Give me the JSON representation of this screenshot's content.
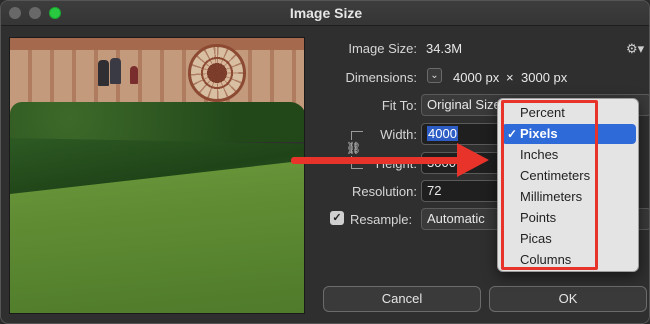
{
  "window": {
    "title": "Image Size"
  },
  "image_size": {
    "label": "Image Size:",
    "value": "34.3M"
  },
  "dimensions": {
    "label": "Dimensions:",
    "width": "4000 px",
    "times": "×",
    "height": "3000 px"
  },
  "fit_to": {
    "label": "Fit To:",
    "value": "Original Size"
  },
  "width": {
    "label": "Width:",
    "value": "4000"
  },
  "height": {
    "label": "Height:",
    "value": "3000"
  },
  "resolution": {
    "label": "Resolution:",
    "value": "72"
  },
  "resample": {
    "label": "Resample:",
    "value": "Automatic",
    "checked": true,
    "check_glyph": "✓"
  },
  "units_menu": {
    "items": [
      "Percent",
      "Pixels",
      "Inches",
      "Centimeters",
      "Millimeters",
      "Points",
      "Picas",
      "Columns"
    ],
    "selected": "Pixels",
    "check_glyph": "✓"
  },
  "buttons": {
    "cancel": "Cancel",
    "ok": "OK"
  },
  "icons": {
    "gear": "gear-icon",
    "link": "link-icon",
    "chevron": "chevron-down-icon"
  },
  "colors": {
    "highlight": "#2f6bd8",
    "annotation": "#e8332b"
  }
}
